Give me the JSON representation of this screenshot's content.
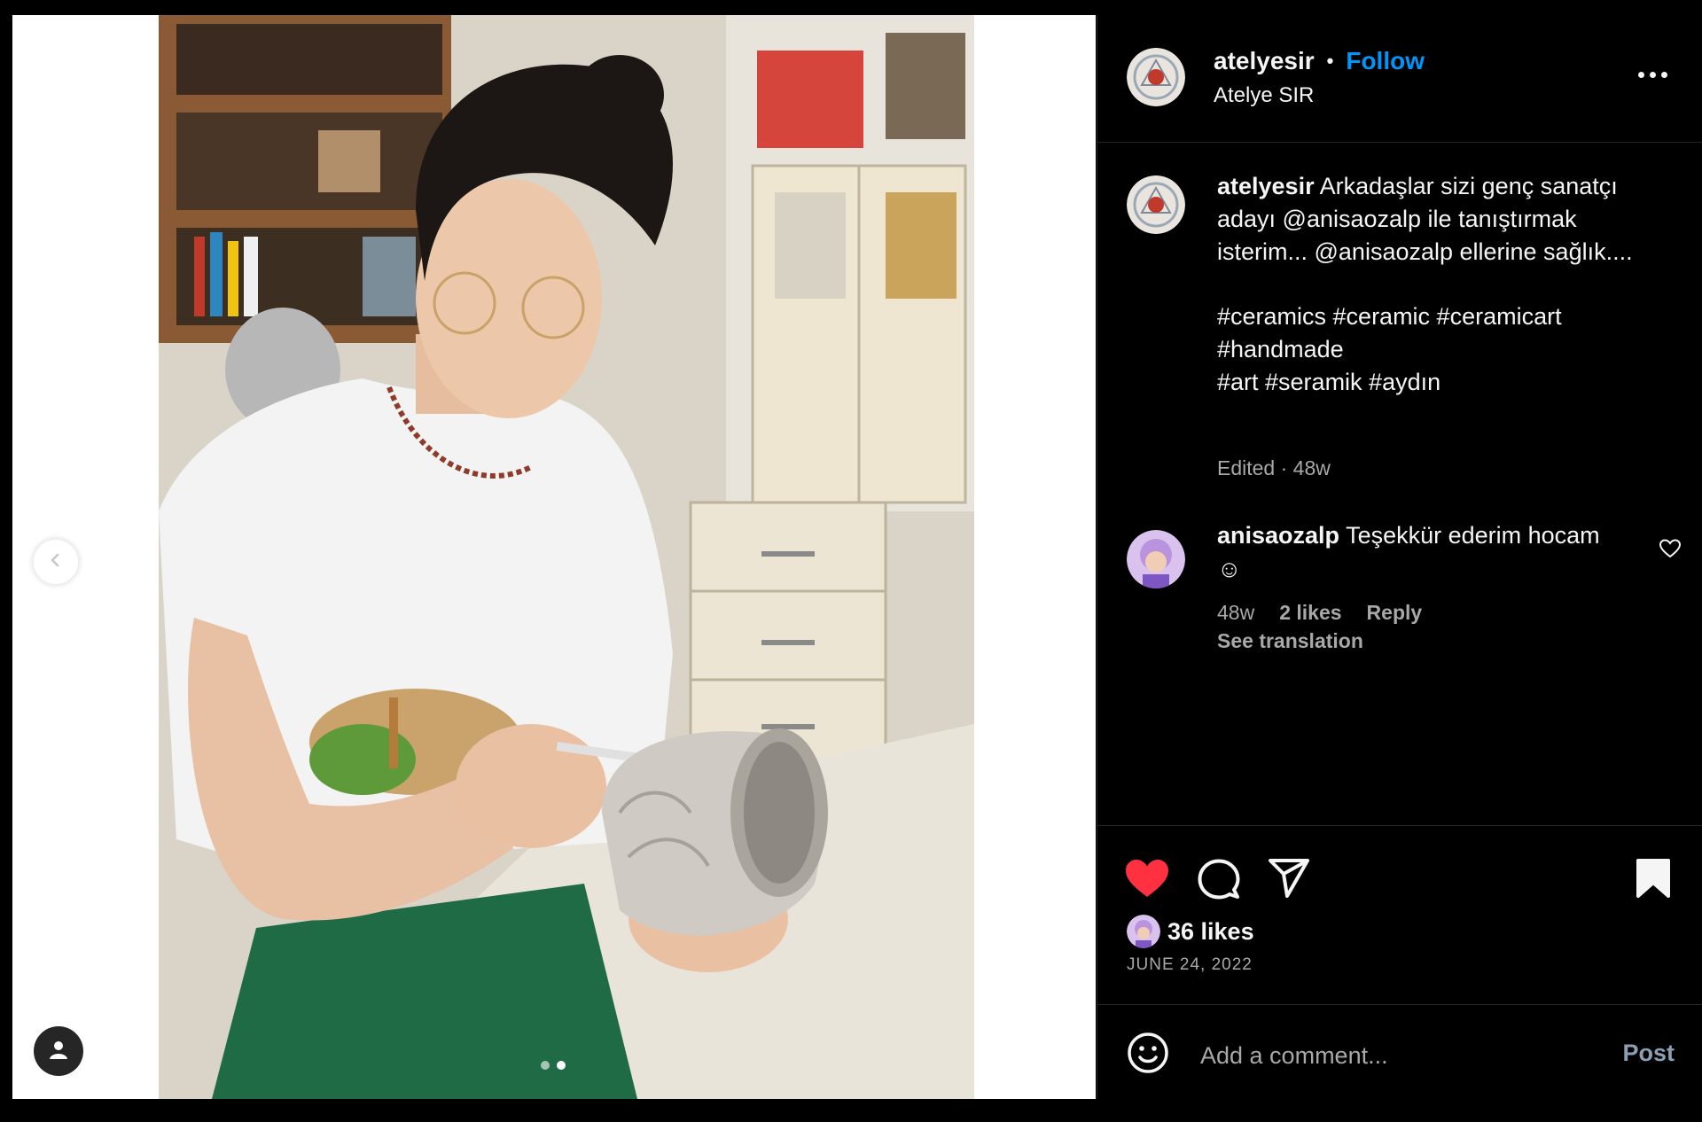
{
  "post": {
    "username": "atelyesir",
    "separator": "•",
    "follow_label": "Follow",
    "location": "Atelye SIR",
    "caption": {
      "username": "atelyesir",
      "text": "Arkadaşlar sizi genç sanatçı adayı @anisaozalp ile tanıştırmak isterim... @anisaozalp ellerine sağlık....",
      "hashtags_line1": "#ceramics #ceramic #ceramicart",
      "hashtags_line2": "#handmade",
      "hashtags_line3": "#art #seramik #aydın",
      "meta": "Edited · 48w"
    },
    "comment": {
      "username": "anisaozalp",
      "text": "Teşekkür ederim hocam ☺",
      "time": "48w",
      "likes": "2 likes",
      "reply_label": "Reply",
      "see_translation": "See translation"
    },
    "likes_text": "36 likes",
    "date": "JUNE 24, 2022",
    "add_comment_placeholder": "Add a comment...",
    "post_label": "Post"
  },
  "carousel": {
    "total": 2,
    "current": 2
  },
  "icons": {
    "like": "heart-filled-icon",
    "comment": "comment-bubble-icon",
    "share": "paper-plane-icon",
    "save": "bookmark-filled-icon",
    "emoji": "smiley-icon",
    "more": "more-options-icon",
    "prev": "chevron-left-icon",
    "tag": "user-tag-icon",
    "comment_like": "heart-outline-icon"
  },
  "colors": {
    "background": "#000000",
    "text": "#f5f5f5",
    "secondary": "#a8a8a8",
    "follow": "#0095f6",
    "like": "#ff3040",
    "border": "#262626"
  }
}
